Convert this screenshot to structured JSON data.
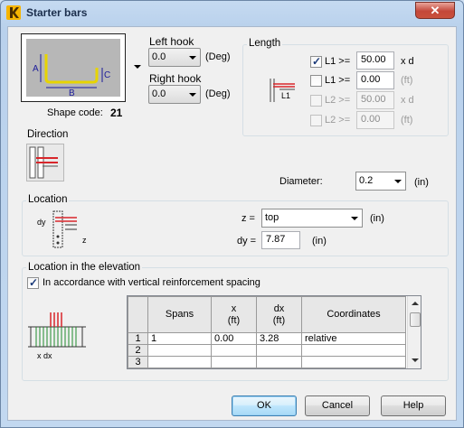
{
  "window": {
    "title": "Starter bars",
    "close_glyph": "✕"
  },
  "shape": {
    "code_label": "Shape code:",
    "code_value": "21",
    "labels": {
      "a": "A",
      "b": "B",
      "c": "C"
    }
  },
  "left_hook": {
    "label": "Left hook",
    "value": "0.0",
    "unit": "(Deg)"
  },
  "right_hook": {
    "label": "Right hook",
    "value": "0.0",
    "unit": "(Deg)"
  },
  "length": {
    "title": "Length",
    "image_label": "L1",
    "rows": [
      {
        "checked": true,
        "enabled": true,
        "label": "L1 >=",
        "value": "50.00",
        "unit": "x d"
      },
      {
        "checked": false,
        "enabled": true,
        "label": "L1 >=",
        "value": "0.00",
        "unit": "(ft)"
      },
      {
        "checked": false,
        "enabled": false,
        "label": "L2 >=",
        "value": "50.00",
        "unit": "x d"
      },
      {
        "checked": false,
        "enabled": false,
        "label": "L2 >=",
        "value": "0.00",
        "unit": "(ft)"
      }
    ]
  },
  "direction": {
    "label": "Direction"
  },
  "diameter": {
    "label": "Diameter:",
    "value": "0.2",
    "unit": "(in)"
  },
  "location": {
    "title": "Location",
    "image_dy": "dy",
    "image_z": "z",
    "z_label": "z =",
    "z_value": "top",
    "z_unit": "(in)",
    "dy_label": "dy =",
    "dy_value": "7.87",
    "dy_unit": "(in)"
  },
  "elevation": {
    "title": "Location in the elevation",
    "checkbox_label": "In accordance with vertical reinforcement spacing",
    "checkbox_checked": true,
    "image_label": "x  dx",
    "columns": [
      {
        "name": "Spans",
        "unit": ""
      },
      {
        "name": "x",
        "unit": "(ft)"
      },
      {
        "name": "dx",
        "unit": "(ft)"
      },
      {
        "name": "Coordinates",
        "unit": ""
      }
    ],
    "rows": [
      {
        "num": "1",
        "spans": "1",
        "x": "0.00",
        "dx": "3.28",
        "coordinates": "relative"
      },
      {
        "num": "2",
        "spans": "",
        "x": "",
        "dx": "",
        "coordinates": ""
      },
      {
        "num": "3",
        "spans": "",
        "x": "",
        "dx": "",
        "coordinates": ""
      }
    ]
  },
  "buttons": {
    "ok": "OK",
    "cancel": "Cancel",
    "help": "Help"
  },
  "colors": {
    "accent": "#f6b400",
    "bar_yellow": "#e7d400",
    "bar_red": "#d8262b",
    "bar_green": "#1e8a2b"
  }
}
